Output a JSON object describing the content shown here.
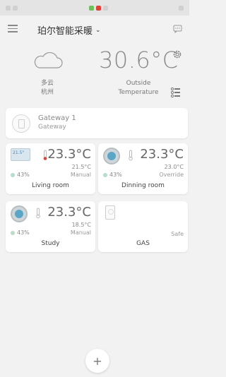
{
  "header": {
    "home_name": "珀尔智能采暖",
    "dropdown_icon": "chevron-down-icon",
    "message_icon": "message-icon"
  },
  "weather": {
    "condition": "多云",
    "city": "杭州",
    "temperature": "30.6°C",
    "outside_line1": "Outside",
    "outside_line2": "Temperature"
  },
  "gateway": {
    "name": "Gateway 1",
    "subtitle": "Gateway"
  },
  "rooms": [
    {
      "name": "Living room",
      "temp": "23.3°C",
      "setpoint": "21.5°C",
      "mode": "Manual",
      "humidity": "43%"
    },
    {
      "name": "Dinning room",
      "temp": "23.3°C",
      "setpoint": "23.0°C",
      "mode": "Override",
      "humidity": "43%"
    },
    {
      "name": "Study",
      "temp": "23.3°C",
      "setpoint": "18.5°C",
      "mode": "Manual",
      "humidity": "43%"
    }
  ],
  "gas": {
    "name": "GAS",
    "status": "Safe"
  },
  "add_label": "+",
  "colors": {
    "background": "#f2f2f2",
    "card": "#ffffff",
    "text_main": "#444444",
    "text_muted": "#888888",
    "heating_red": "#e0403a",
    "humidity_green": "#b7dcc7"
  }
}
